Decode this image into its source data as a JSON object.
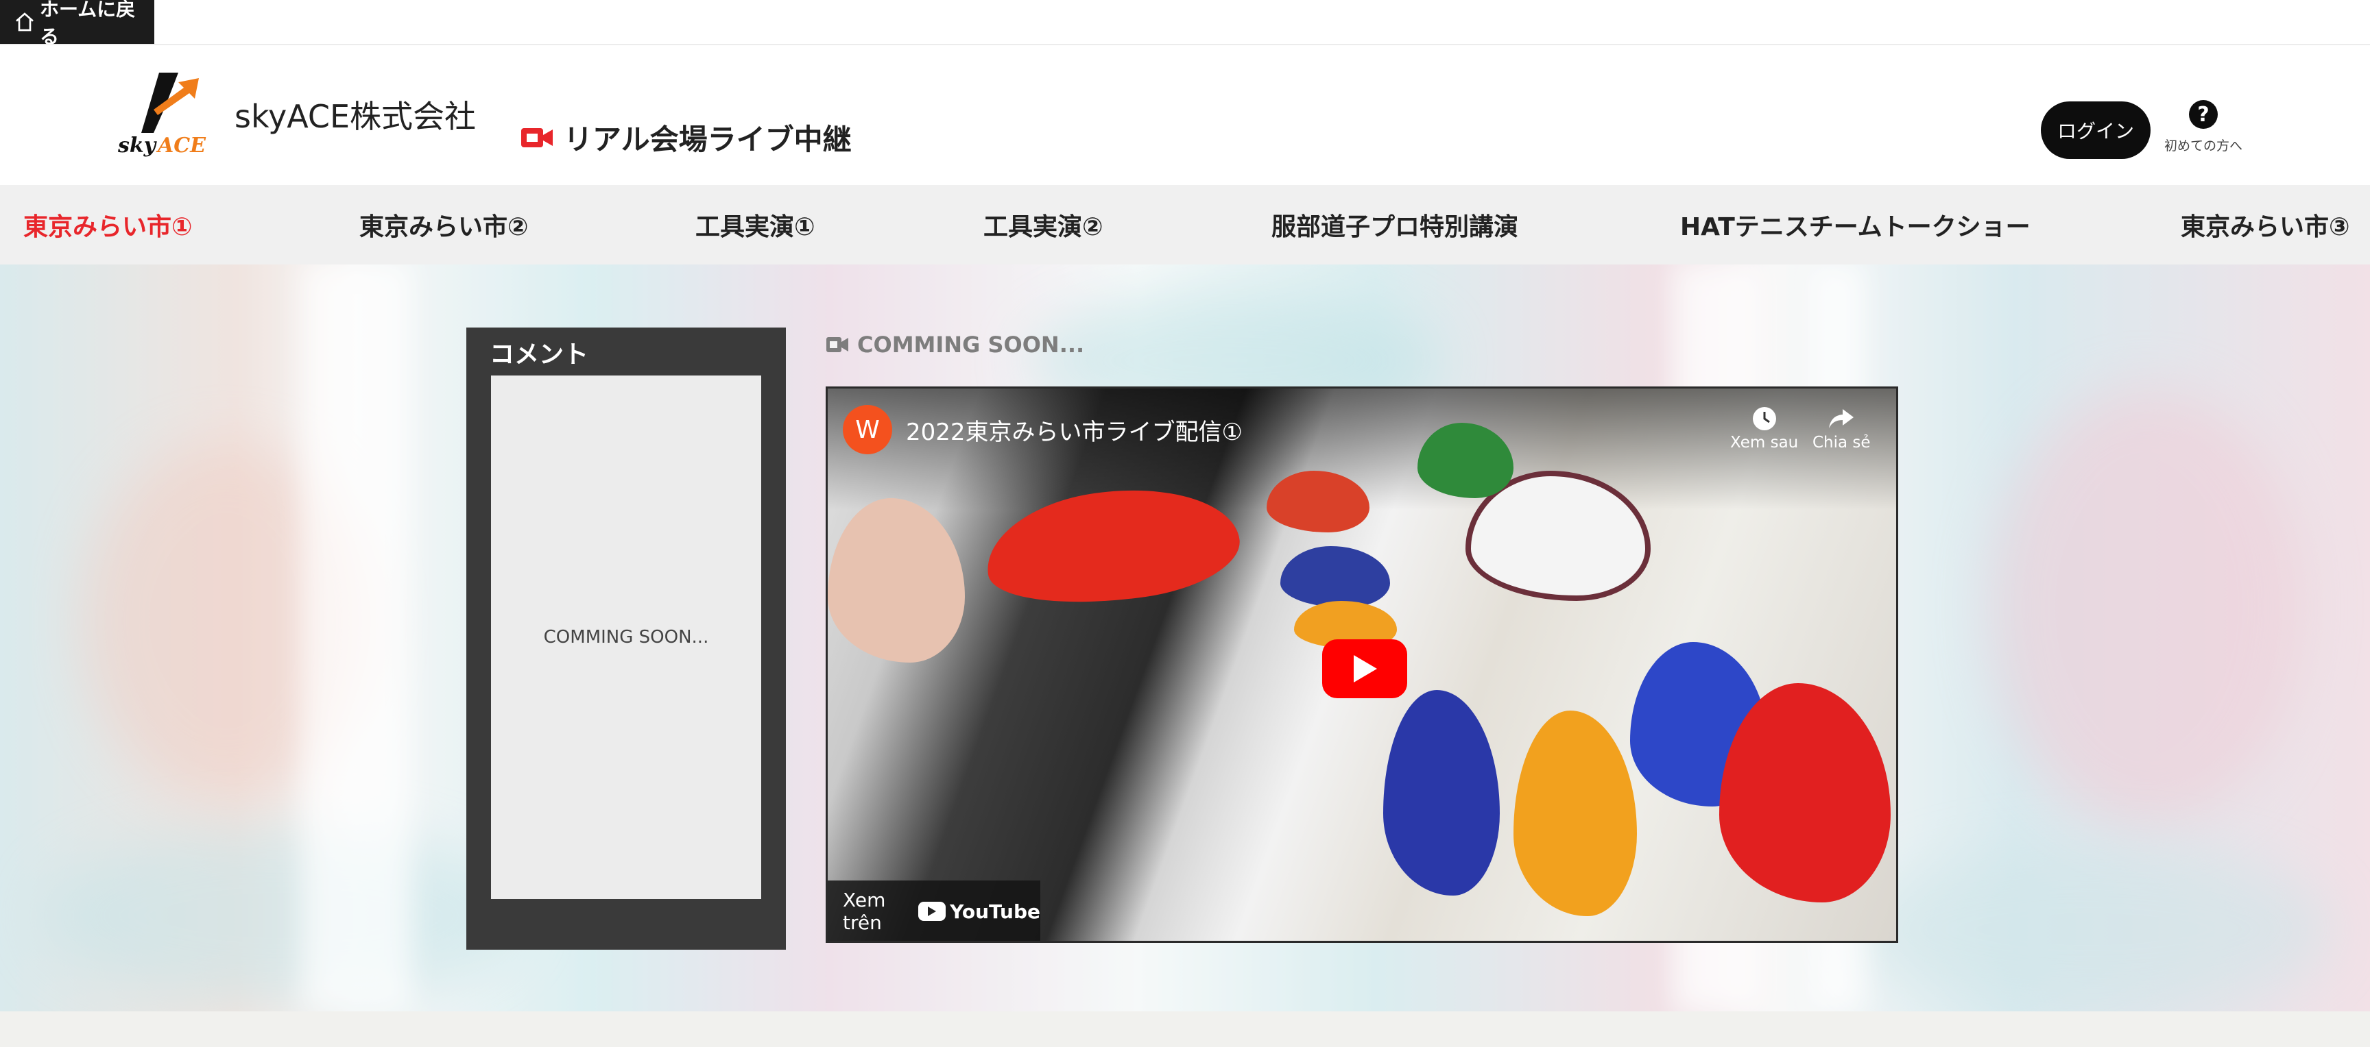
{
  "topbar": {
    "home_label": "ホームに戻る"
  },
  "header": {
    "company": "skyACE株式会社",
    "logo_text": "skyACE",
    "live_label": "リアル会場ライブ中継",
    "login_label": "ログイン",
    "help_label": "初めての方へ",
    "help_glyph": "?"
  },
  "nav": {
    "tabs": [
      {
        "label": "東京みらい市①",
        "active": true
      },
      {
        "label": "東京みらい市②",
        "active": false
      },
      {
        "label": "工具実演①",
        "active": false
      },
      {
        "label": "工具実演②",
        "active": false
      },
      {
        "label": "服部道子プロ特別講演",
        "active": false
      },
      {
        "label": "HATテニスチームトークショー",
        "active": false
      },
      {
        "label": "東京みらい市③",
        "active": false
      }
    ]
  },
  "comments": {
    "title": "コメント",
    "placeholder": "COMMING SOON..."
  },
  "stream": {
    "status": "COMMING SOON...",
    "channel_initial": "W",
    "video_title": "2022東京みらい市ライブ配信①",
    "watch_later": "Xem sau",
    "share": "Chia sẻ",
    "watch_on": "Xem trên",
    "youtube": "YouTube"
  },
  "colors": {
    "accent_red": "#e8262b",
    "logo_orange": "#f07d1a",
    "dark": "#0d0d0d"
  }
}
